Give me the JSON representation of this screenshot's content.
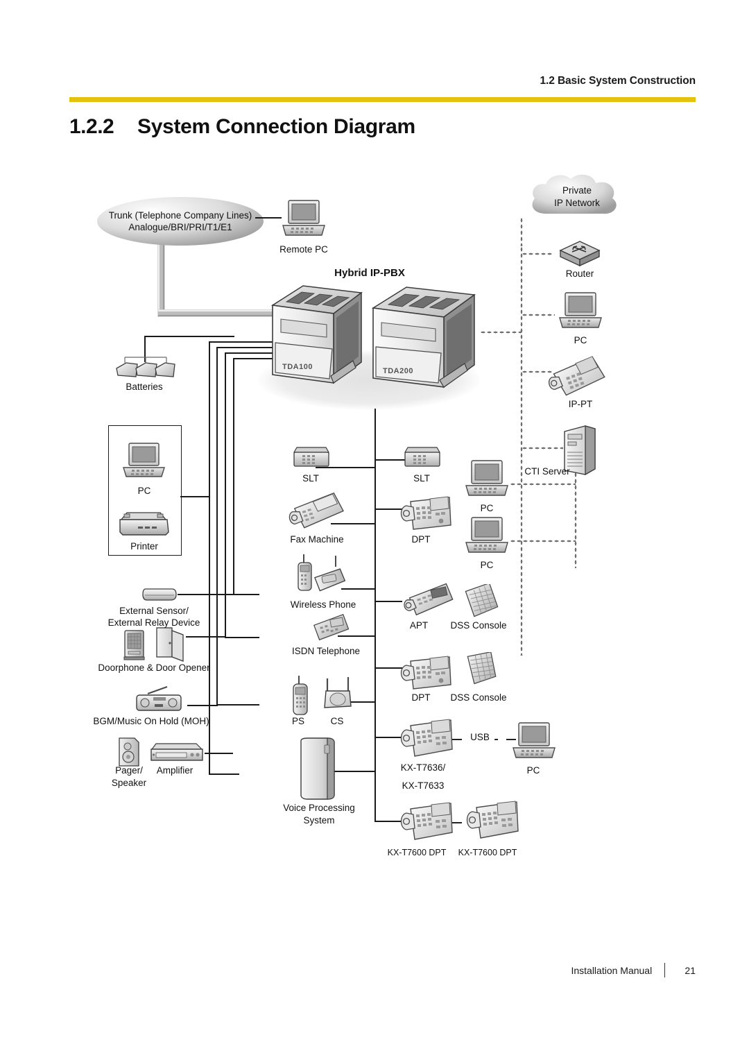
{
  "header": {
    "section": "1.2 Basic System Construction",
    "number": "1.2.2",
    "title": "System Connection Diagram"
  },
  "footer": {
    "manual": "Installation Manual",
    "page": "21"
  },
  "colors": {
    "rule": "#E3C10C",
    "line": "#1a1a1a",
    "cable": "#bdbdbd",
    "dotted": "#6e6e6e"
  },
  "diagram": {
    "pbx_title": "Hybrid IP-PBX",
    "trunk_line1": "Trunk (Telephone Company Lines)",
    "trunk_line2": "Analogue/BRI/PRI/T1/E1",
    "cloud_line1": "Private",
    "cloud_line2": "IP Network",
    "cabinets": [
      {
        "model": "TDA100"
      },
      {
        "model": "TDA200"
      }
    ],
    "nodes": {
      "remote_pc": "Remote PC",
      "router": "Router",
      "ip_pc": "PC",
      "ip_pt": "IP-PT",
      "cti_server": "CTI Server",
      "cti_pc1": "PC",
      "cti_pc2": "PC",
      "batteries": "Batteries",
      "pc": "PC",
      "printer": "Printer",
      "ext_sensor_l1": "External Sensor/",
      "ext_sensor_l2": "External Relay Device",
      "doorphone": "Doorphone & Door Opener",
      "bgm": "BGM/Music On Hold (MOH)",
      "pager_l1": "Pager/",
      "pager_l2": "Speaker",
      "amplifier": "Amplifier",
      "slt_left": "SLT",
      "slt_right": "SLT",
      "fax": "Fax Machine",
      "dpt_top": "DPT",
      "wireless": "Wireless Phone",
      "apt": "APT",
      "dss_top": "DSS Console",
      "isdn": "ISDN Telephone",
      "dpt_mid": "DPT",
      "dss_mid": "DSS Console",
      "ps": "PS",
      "cs": "CS",
      "kx7636_l1": "KX-T7636/",
      "kx7636_l2": "KX-T7633",
      "usb": "USB",
      "usb_pc": "PC",
      "vps_l1": "Voice Processing",
      "vps_l2": "System",
      "kx7600_a": "KX-T7600 DPT",
      "kx7600_b": "KX-T7600 DPT"
    }
  }
}
